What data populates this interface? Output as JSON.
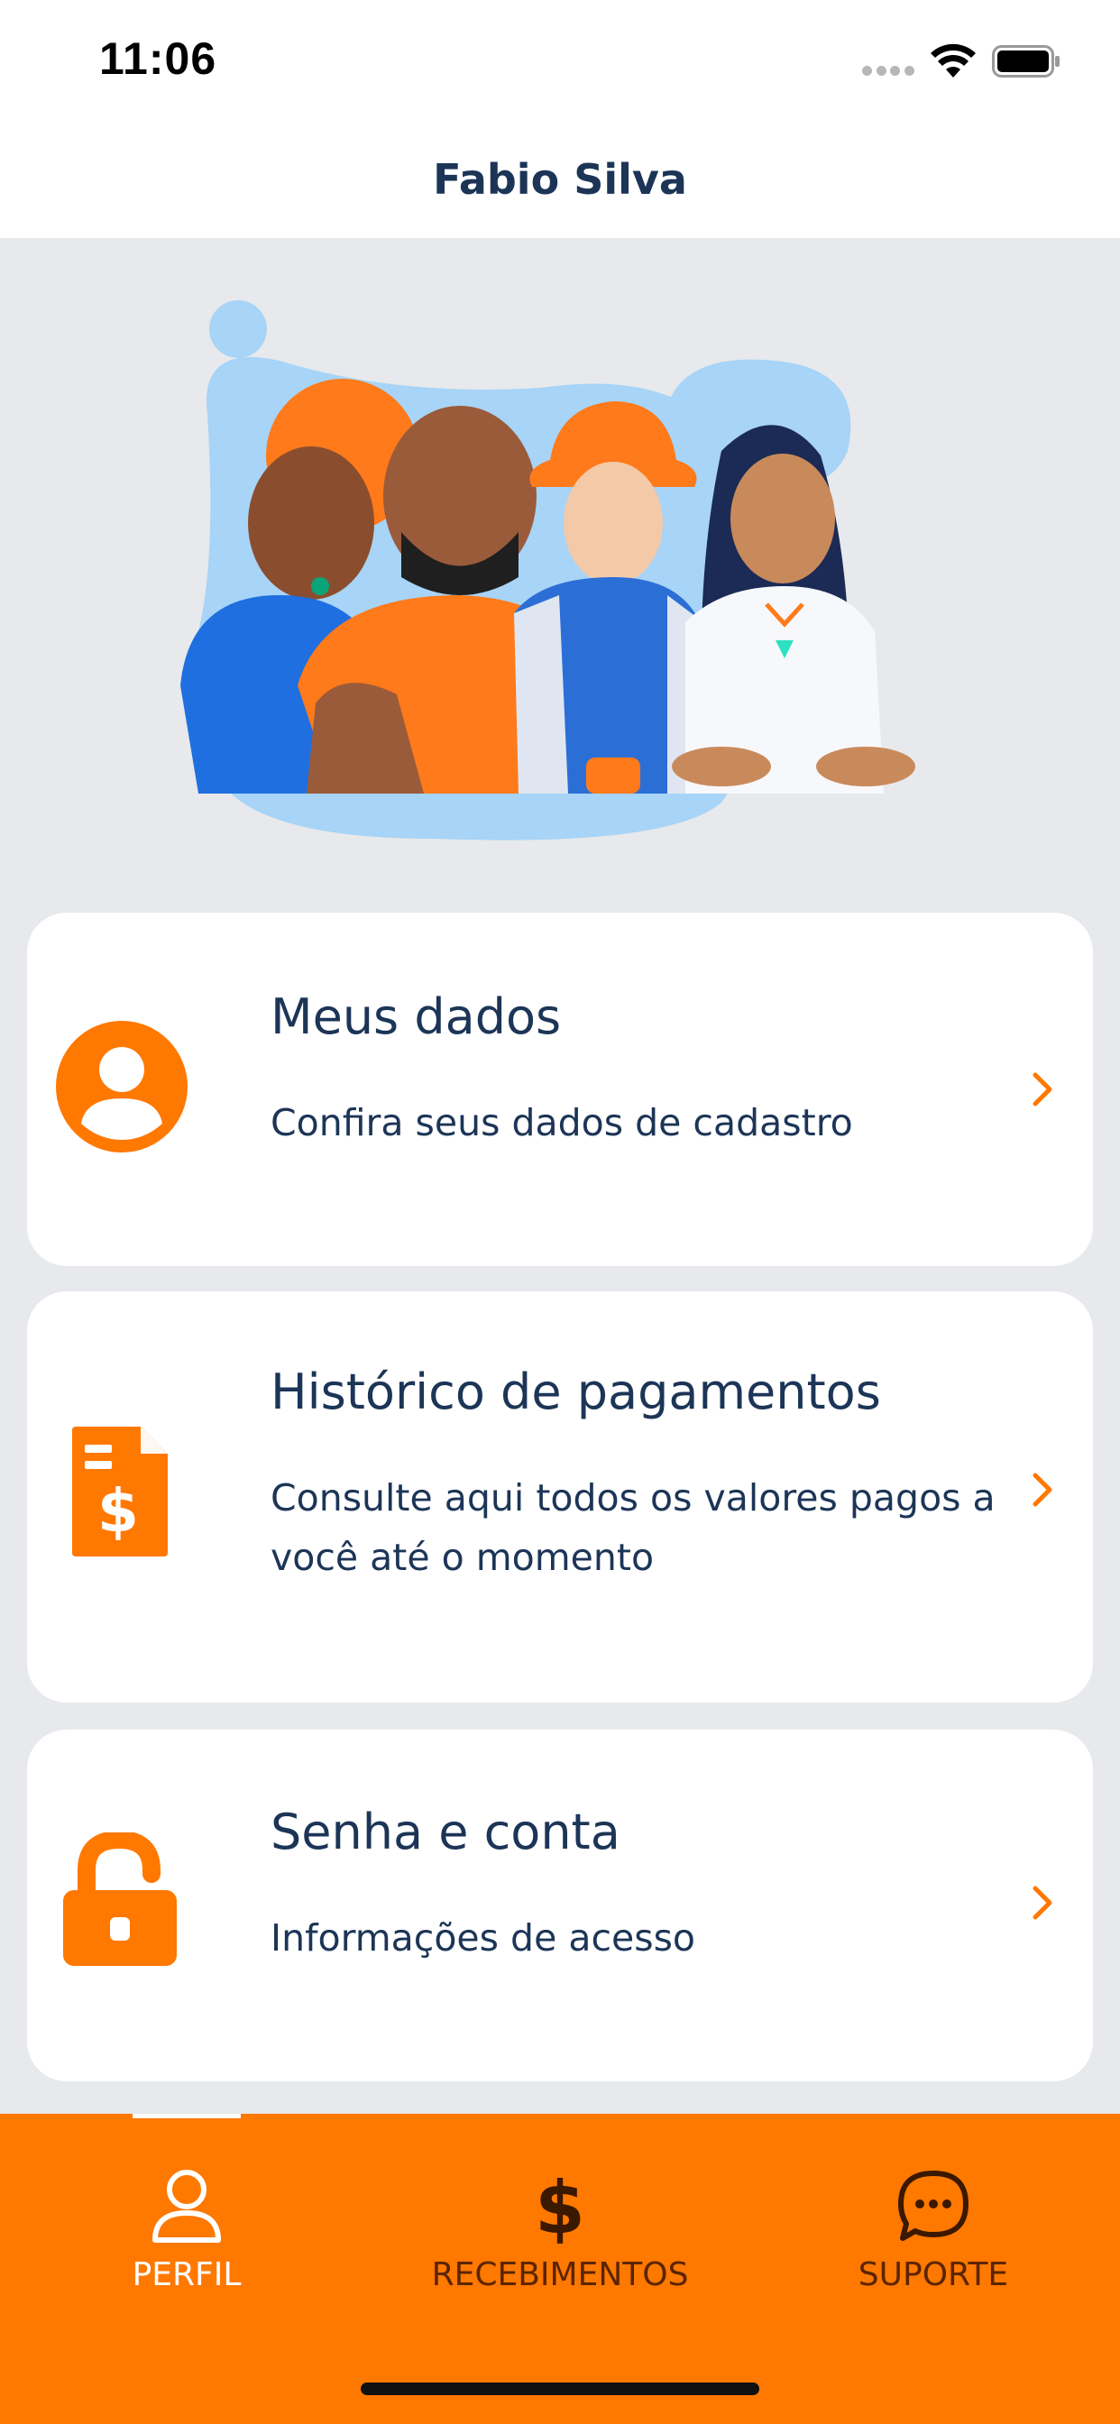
{
  "status_bar": {
    "time": "11:06"
  },
  "header": {
    "title": "Fabio Silva"
  },
  "menu": {
    "items": [
      {
        "title": "Meus dados",
        "description": "Confira seus dados de cadastro",
        "icon": "user-circle-icon"
      },
      {
        "title": "Histórico de pagamentos",
        "description": "Consulte aqui todos os valores pagos a você até o momento",
        "icon": "payment-document-icon"
      },
      {
        "title": "Senha e conta",
        "description": "Informações de acesso",
        "icon": "unlock-icon"
      }
    ]
  },
  "tab_bar": {
    "tabs": [
      {
        "label": "PERFIL",
        "icon": "person-icon",
        "active": true
      },
      {
        "label": "RECEBIMENTOS",
        "icon": "dollar-icon",
        "active": false
      },
      {
        "label": "SUPORTE",
        "icon": "chat-bubble-icon",
        "active": false
      }
    ]
  },
  "colors": {
    "accent": "#ff7800",
    "text_primary": "#1c3557",
    "background": "#e7e9ec",
    "card": "#ffffff"
  }
}
